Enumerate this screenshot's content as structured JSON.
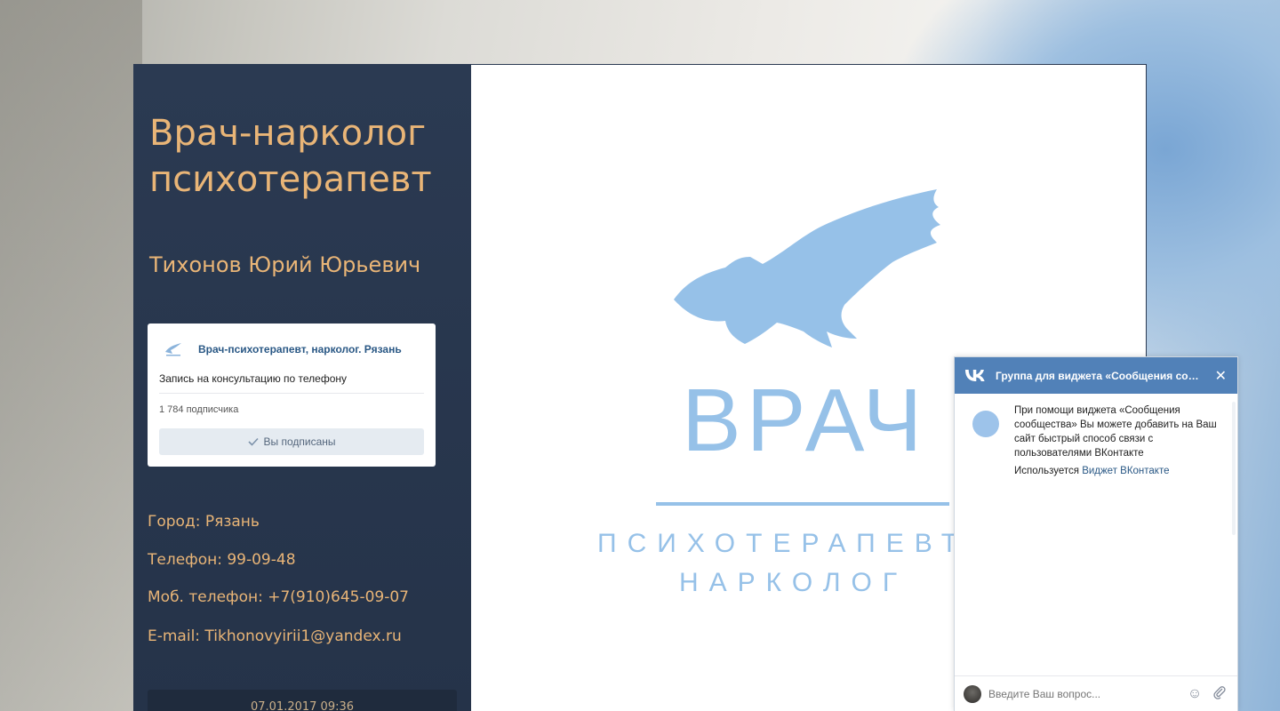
{
  "sidebar": {
    "title_line1": "Врач-нарколог",
    "title_line2": "психотерапевт",
    "doctor_name": "Тихонов Юрий Юрьевич",
    "vk_group": {
      "name": "Врач-психотерапевт, нарколог. Рязань",
      "status": "Запись на консультацию по телефону",
      "subscribers": "1 784 подписчика",
      "subscribed_label": "Вы подписаны",
      "icon": "check-icon"
    },
    "city": "Город: Рязань",
    "phone": "Телефон: 99-09-48",
    "mobile": "Моб. телефон: +7(910)645-09-07",
    "email": "E-mail: Tikhonovyirii1@yandex.ru",
    "date": "07.01.2017 09:36"
  },
  "main": {
    "logo_word": "ВРАЧ",
    "logo_sub1": "ПСИХОТЕРАПЕВТ",
    "logo_sub2": "НАРКОЛОГ",
    "logo_color": "#96c1e8"
  },
  "vk_widget": {
    "header_title": "Группа для виджета «Сообщения со…",
    "close_label": "✕",
    "message": "При помощи виджета «Сообщения сообщества» Вы можете добавить на Ваш сайт быстрый способ связи с пользователями ВКонтакте",
    "used_prefix": "Используется",
    "used_link": "Виджет ВКонтакте",
    "input_placeholder": "Введите Ваш вопрос...",
    "accent_color": "#5181b8",
    "icons": [
      "vk-logo-icon",
      "close-icon",
      "emoji-icon",
      "attach-icon"
    ]
  }
}
